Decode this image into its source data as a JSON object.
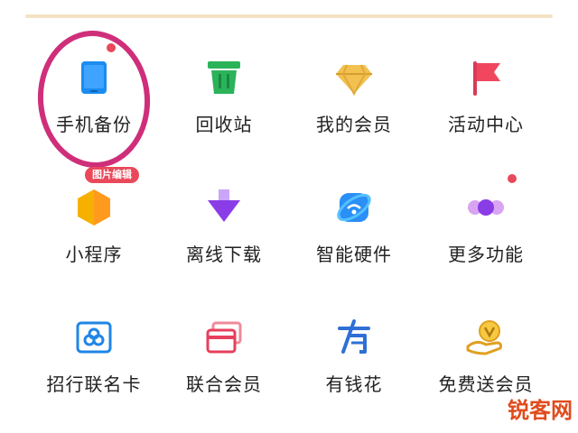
{
  "grid": {
    "items": [
      {
        "label": "手机备份",
        "icon": "phone-icon"
      },
      {
        "label": "回收站",
        "icon": "trash-icon"
      },
      {
        "label": "我的会员",
        "icon": "diamond-icon"
      },
      {
        "label": "活动中心",
        "icon": "flag-icon"
      },
      {
        "label": "小程序",
        "icon": "hexagon-icon"
      },
      {
        "label": "离线下载",
        "icon": "download-arrow-icon"
      },
      {
        "label": "智能硬件",
        "icon": "wifi-device-icon"
      },
      {
        "label": "更多功能",
        "icon": "more-dots-icon"
      },
      {
        "label": "招行联名卡",
        "icon": "bank-card-icon"
      },
      {
        "label": "联合会员",
        "icon": "cards-icon"
      },
      {
        "label": "有钱花",
        "icon": "money-flower-icon"
      },
      {
        "label": "免费送会员",
        "icon": "gift-hand-icon"
      }
    ]
  },
  "tag": {
    "text": "图片编辑"
  },
  "watermark": {
    "text": "锐客网"
  },
  "colors": {
    "accent_red": "#e9495a",
    "highlight_ring": "#cf2f7a",
    "divider": "#f3e3c4"
  }
}
